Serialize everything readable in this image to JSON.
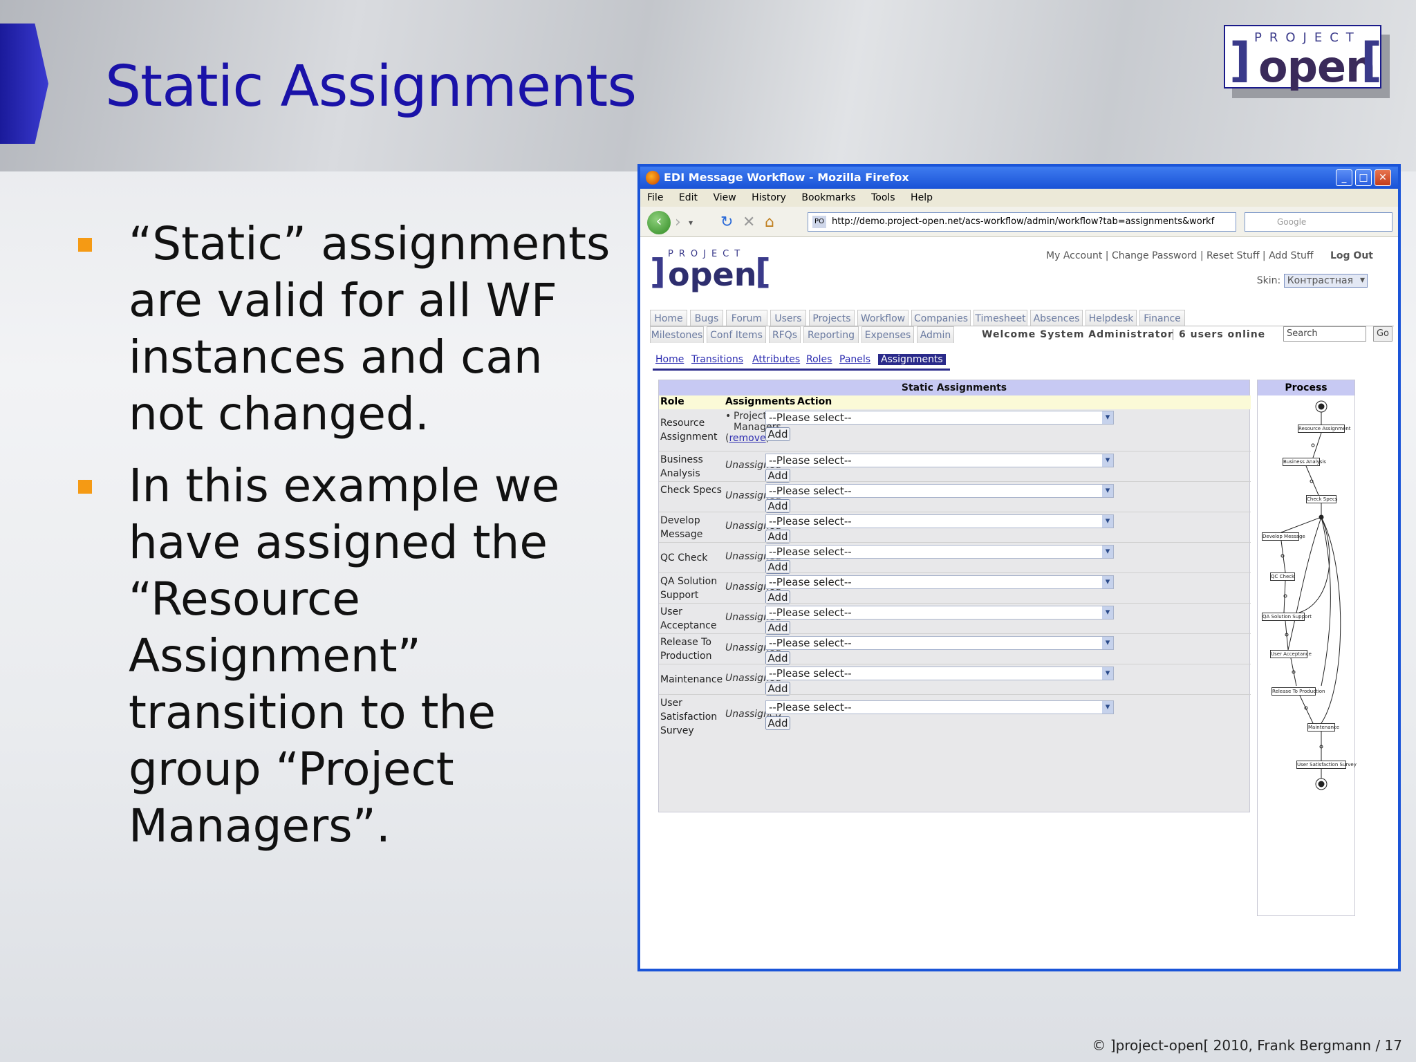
{
  "slide": {
    "title": "Static Assignments",
    "bullets": [
      "“Static” assignments are valid for all WF instances and can not changed.",
      "In this example we have assigned the “Resource Assignment” transition to the group “Project Managers”."
    ],
    "footer": "©  ]project-open[  2010, Frank Bergmann / 17",
    "logo": {
      "top": "PROJECT",
      "main": "open",
      "bracket_left": "]",
      "bracket_right": "["
    }
  },
  "browser": {
    "title": "EDI Message Workflow - Mozilla Firefox",
    "menu": [
      "File",
      "Edit",
      "View",
      "History",
      "Bookmarks",
      "Tools",
      "Help"
    ],
    "url": "http://demo.project-open.net/acs-workflow/admin/workflow?tab=assignments&workf",
    "search_placeholder": "Google",
    "controls": {
      "minimize": "_",
      "maximize": "□",
      "close": "✕"
    }
  },
  "app": {
    "top_links": "My Account | Change Password | Reset Stuff | Add Stuff",
    "logout": "Log Out",
    "skin_label": "Skin:",
    "skin_value": "Контрастная",
    "tabs_row1": [
      "Home",
      "Bugs",
      "Forum",
      "Users",
      "Projects",
      "Workflow",
      "Companies",
      "Timesheet",
      "Absences",
      "Helpdesk",
      "Finance"
    ],
    "tabs_row2": [
      "Milestones",
      "Conf Items",
      "RFQs",
      "Reporting",
      "Expenses",
      "Admin"
    ],
    "welcome": "Welcome System Administrator",
    "users_online": "6 users online",
    "search_value": "Search",
    "go": "Go",
    "subtabs": [
      "Home",
      "Transitions",
      "Attributes",
      "Roles",
      "Panels",
      "Assignments"
    ],
    "panel_title": "Static Assignments",
    "columns": [
      "Role",
      "Assignments",
      "Action"
    ],
    "select_value": "--Please select--",
    "add_label": "Add",
    "rows": [
      {
        "role": "Resource Assignment",
        "assignment": "Project Managers",
        "remove": "remove"
      },
      {
        "role": "Business Analysis",
        "assignment": "Unassigned"
      },
      {
        "role": "Check Specs",
        "assignment": "Unassigned"
      },
      {
        "role": "Develop Message",
        "assignment": "Unassigned"
      },
      {
        "role": "QC Check",
        "assignment": "Unassigned"
      },
      {
        "role": "QA Solution Support",
        "assignment": "Unassigned"
      },
      {
        "role": "User Acceptance",
        "assignment": "Unassigned"
      },
      {
        "role": "Release To Production",
        "assignment": "Unassigned"
      },
      {
        "role": "Maintenance",
        "assignment": "Unassigned"
      },
      {
        "role": "User Satisfaction Survey",
        "assignment": "Unassigned"
      }
    ],
    "process_title": "Process",
    "process_nodes": [
      "Resource Assignment",
      "Business Analysis",
      "Check Specs",
      "Develop Message",
      "QC Check",
      "QA Solution Support",
      "User Acceptance",
      "Release To Production",
      "Maintenance",
      "User Satisfaction Survey"
    ]
  }
}
